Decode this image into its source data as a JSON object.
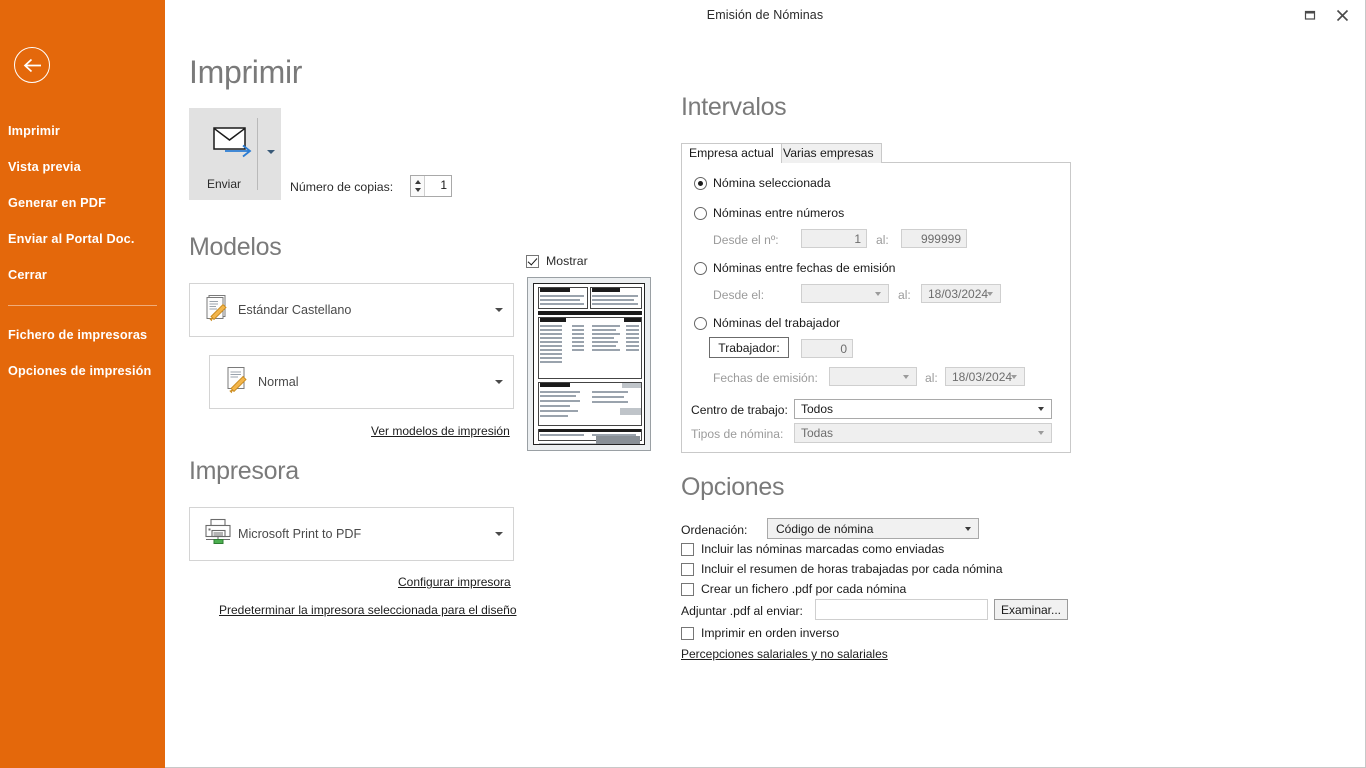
{
  "window": {
    "title": "Emisión de Nóminas",
    "restore_icon": "restore-icon",
    "close_icon": "close-icon"
  },
  "rail": {
    "back_icon": "back-arrow-icon",
    "items": [
      {
        "label": "Imprimir"
      },
      {
        "label": "Vista previa"
      },
      {
        "label": "Generar en PDF"
      },
      {
        "label": "Enviar al Portal Doc."
      },
      {
        "label": "Cerrar"
      }
    ],
    "items_bottom": [
      {
        "label": "Fichero de impresoras"
      },
      {
        "label": "Opciones de impresión"
      }
    ],
    "accent_color": "#e4680b"
  },
  "print": {
    "heading": "Imprimir",
    "send_button_label": "Enviar",
    "send_icon": "envelope-send-icon",
    "copies_label": "Número de copias:",
    "copies_value": "1"
  },
  "models": {
    "heading": "Modelos",
    "model_value": "Estándar Castellano",
    "model_icon": "document-template-icon",
    "variant_value": "Normal",
    "variant_icon": "document-template-icon",
    "link_label": "Ver modelos de impresión"
  },
  "printer": {
    "heading": "Impresora",
    "printer_value": "Microsoft Print to PDF",
    "printer_icon": "printer-icon",
    "configure_link": "Configurar impresora",
    "default_link": "Predeterminar la impresora seleccionada para el diseño"
  },
  "preview": {
    "show_label": "Mostrar",
    "show_checked": true
  },
  "intervals": {
    "heading": "Intervalos",
    "tabs": [
      {
        "label": "Empresa actual",
        "active": true
      },
      {
        "label": "Varias empresas",
        "active": false
      }
    ],
    "radio_selected_label": "Nómina seleccionada",
    "radio_numbers_label": "Nóminas entre números",
    "numbers_from_label": "Desde el nº:",
    "numbers_from_value": "1",
    "numbers_to_label": "al:",
    "numbers_to_value": "999999",
    "radio_dates_label": "Nóminas entre fechas de emisión",
    "dates_from_label": "Desde el:",
    "dates_from_value": "",
    "dates_to_label": "al:",
    "dates_to_value": "18/03/2024",
    "radio_worker_label": "Nóminas del trabajador",
    "worker_button_label": "Trabajador:",
    "worker_value": "0",
    "worker_dates_label": "Fechas de emisión:",
    "worker_dates_from_value": "",
    "worker_dates_to_label": "al:",
    "worker_dates_to_value": "18/03/2024",
    "workcenter_label": "Centro de trabajo:",
    "workcenter_value": "Todos",
    "payrolltypes_label": "Tipos de nómina:",
    "payrolltypes_value": "Todas"
  },
  "options": {
    "heading": "Opciones",
    "order_label": "Ordenación:",
    "order_value": "Código de nómina",
    "checkboxes": [
      {
        "label": "Incluir las nóminas marcadas como enviadas",
        "checked": false
      },
      {
        "label": "Incluir el resumen de horas trabajadas por cada nómina",
        "checked": false
      },
      {
        "label": "Crear un fichero .pdf por cada nómina",
        "checked": false
      }
    ],
    "attach_label": "Adjuntar .pdf al enviar:",
    "attach_value": "",
    "browse_button_label": "Examinar...",
    "reverse_label": "Imprimir en orden inverso",
    "reverse_checked": false,
    "perceptions_link": "Percepciones salariales y no salariales"
  }
}
